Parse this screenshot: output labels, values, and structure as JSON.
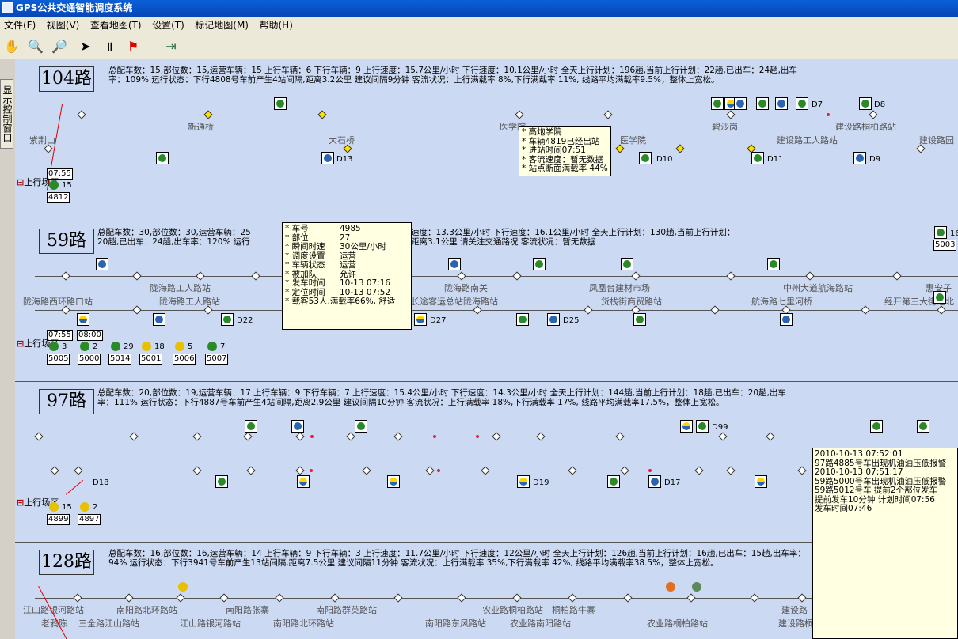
{
  "window": {
    "title": "GPS公共交通智能调度系统"
  },
  "menu": [
    "文件(F)",
    "视图(V)",
    "查看地图(T)",
    "设置(T)",
    "标记地图(M)",
    "帮助(H)"
  ],
  "toolbar": {
    "icons": [
      "hand-icon",
      "zoom-in-icon",
      "zoom-out-icon",
      "pointer-icon",
      "pause-icon",
      "flag-icon",
      "exit-icon"
    ]
  },
  "side_tab": "显示控制窗口",
  "routes": [
    {
      "name": "104路",
      "stats": "总配车数：15,部位数：15,运营车辆：15 上行车辆：6 下行车辆：9 上行速度：15.7公里/小时 下行速度：10.1公里/小时 全天上行计划：196趟,当前上行计划：22趟,已出车：24趟,出车率：109% 运行状态：下行4808号车前产生4站间隔,距离3.2公里 建议间隔9分钟 客流状况：上行满载率 8%,下行满载率 11%, 线路平均满载率9.5%，整体上宽松。",
      "stations_upper": [
        "新通桥",
        "医学院",
        "碧沙岗",
        "建设路桐柏路站"
      ],
      "stations_lower": [
        "紫荆山",
        "大石桥",
        "医学院",
        "建设路工人路站",
        "建设路园"
      ],
      "bus_tags": [
        "D7",
        "D8",
        "D13",
        "D10",
        "D11",
        "D9"
      ],
      "yard": {
        "label": "上行场区",
        "time": "07:55",
        "count": "15",
        "vehicle": "4812"
      }
    },
    {
      "name": "59路",
      "stats_line1": "总配车数：30,部位数：30,运营车辆：25",
      "stats_line1b": "速度：13.3公里/小时 下行速度：16.1公里/小时 全天上行计划：130趟,当前上行计划：",
      "stats_line2": "20趟,已出车：24趟,出车率：120% 运行",
      "stats_line2b": "距离3.1公里 请关注交通路况 客流状况：暂无数据",
      "stations_upper": [
        "陇海路工人路站",
        "陇海路南关",
        "凤凰台建材市场",
        "中州大道航海路站",
        "惠安子"
      ],
      "stations_lower": [
        "陇海路西环路口站",
        "陇海路工人路站",
        "长途客运总站陇海路站",
        "货栈街商贸路站",
        "航海路七里河桥",
        "经开第三大街经北"
      ],
      "bus_tags": [
        "D22",
        "D27",
        "D25"
      ],
      "top_right_tag": "16",
      "top_right_vehicle": "5003",
      "yard": {
        "label": "上行场区",
        "times": [
          "07:55",
          "08:00"
        ],
        "items": [
          {
            "count": "3",
            "vehicle": "5005"
          },
          {
            "count": "2",
            "vehicle": "5000"
          },
          {
            "count": "29",
            "vehicle": "5014"
          },
          {
            "count": "18",
            "vehicle": "5001"
          },
          {
            "count": "5",
            "vehicle": "5006"
          },
          {
            "count": "7",
            "vehicle": "5007"
          }
        ]
      }
    },
    {
      "name": "97路",
      "stats": "总配车数：20,部位数：19,运营车辆：17 上行车辆：9 下行车辆：7 上行速度：15.4公里/小时 下行速度：14.3公里/小时 全天上行计划：144趟,当前上行计划：18趟,已出车：20趟,出车率：111% 运行状态：下行4887号车前产生4站间隔,距离2.9公里 建议间隔10分钟 客流状况：上行满载率 18%,下行满载率 17%, 线路平均满载率17.5%，整体上宽松。",
      "bus_tags": [
        "D99",
        "D18",
        "D19",
        "D17"
      ],
      "yard": {
        "label": "上行场区",
        "items": [
          {
            "count": "15",
            "vehicle": "4899"
          },
          {
            "count": "2",
            "vehicle": "4897"
          }
        ]
      }
    },
    {
      "name": "128路",
      "stats": "总配车数：16,部位数：16,运营车辆：14 上行车辆：9 下行车辆：3 上行速度：11.7公里/小时 下行速度：12公里/小时 全天上行计划：126趟,当前上行计划：16趟,已出车：15趟,出车率：94% 运行状态：下行3941号车前产生13站间隔,距离7.5公里 建议间隔11分钟 客流状况：上行满载率 35%,下行满载率 42%, 线路平均满载率38.5%，整体上宽松。",
      "stations_upper": [
        "江山路银河路站",
        "南阳路北环路站",
        "南阳路张寨",
        "南阳路群英路站",
        "农业路桐柏路站",
        "桐柏路牛寨",
        "建设路"
      ],
      "stations_lower": [
        "老鸦陈",
        "三全路江山路站",
        "江山路银河路站",
        "南阳路北环路站",
        "南阳路东风路站",
        "农业路南阳路站",
        "农业路桐柏路站",
        "建设路桐柏"
      ]
    }
  ],
  "popup_station": [
    "高炮学院",
    "车辆4819已经出站",
    "进站时间07:51",
    "客流速度：暂无数据",
    "站点断面满载率 44%"
  ],
  "popup_vehicle": [
    {
      "k": "车号",
      "v": "4985"
    },
    {
      "k": "部位",
      "v": "27"
    },
    {
      "k": "瞬间时速",
      "v": "30公里/小时"
    },
    {
      "k": "调度设置",
      "v": "运营"
    },
    {
      "k": "车辆状态",
      "v": "运营"
    },
    {
      "k": "被加队",
      "v": "允许"
    },
    {
      "k": "发车时间",
      "v": "10-13 07:16"
    },
    {
      "k": "定位时间",
      "v": "10-13 07:52"
    },
    {
      "k": "载客53人,",
      "v": "满载率66%, 舒适"
    }
  ],
  "alarm_log": [
    "2010-10-13 07:52:01",
    "97路4885号车出现机油油压低报警",
    "2010-10-13 07:51:17",
    "59路5000号车出现机油油压低报警",
    "59路5012号车 提前2个部位发车",
    "提前发车10分钟 计划时间07:56",
    "发车时间07:46"
  ]
}
